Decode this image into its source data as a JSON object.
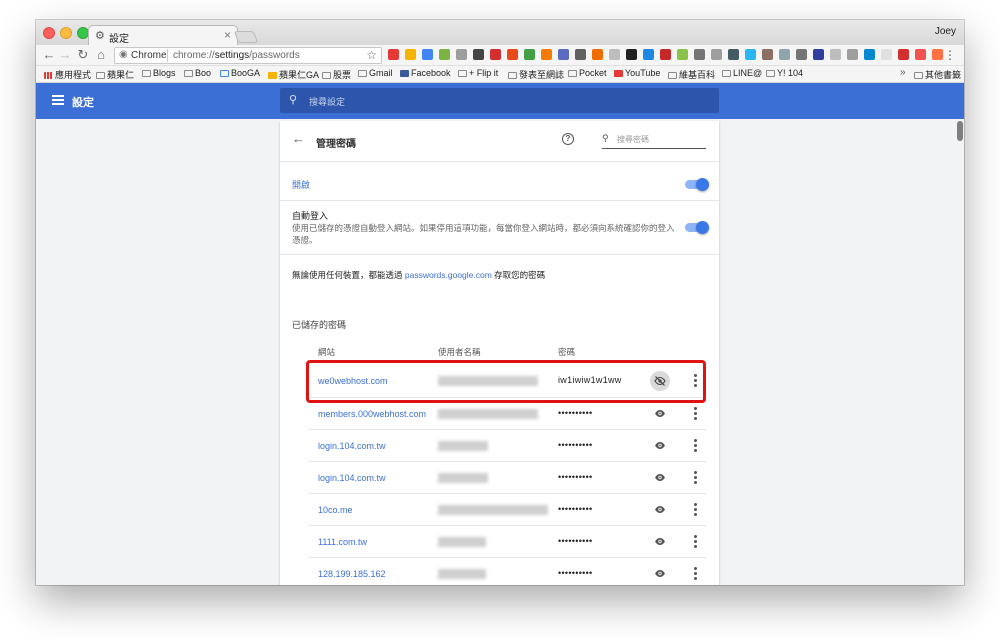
{
  "tab": {
    "title": "設定",
    "close": "×"
  },
  "profile": "Joey",
  "omnibox": {
    "scheme": "Chrome",
    "url_prefix": "chrome://",
    "url_host": "settings",
    "url_path": "/passwords"
  },
  "bookmarks": {
    "apps": "應用程式",
    "items": [
      "蘋果仁",
      "Blogs",
      "Boo",
      "BooGA",
      "蘋果仁GA",
      "股票",
      "Gmail",
      "Facebook",
      "+ Flip it",
      "發表至網誌",
      "Pocket",
      "YouTube",
      "維基百科",
      "LINE@",
      "Y! 104"
    ],
    "more": "»",
    "other": "其他書籤"
  },
  "settings_header": {
    "title": "設定",
    "search_placeholder": "搜尋設定"
  },
  "passwords": {
    "title": "管理密碼",
    "search_placeholder": "搜尋密碼",
    "enabled_label": "開啟",
    "autosignin_title": "自動登入",
    "autosignin_desc": "使用已儲存的憑證自動登入網站。如果停用這項功能，每當你登入網站時，都必須向系統確認你的登入憑證。",
    "info_before": "無論使用任何裝置，都能透過 ",
    "info_link": "passwords.google.com",
    "info_after": " 存取您的密碼",
    "saved_title": "已儲存的密碼",
    "col_site": "網站",
    "col_user": "使用者名稱",
    "col_password": "密碼",
    "rows": [
      {
        "site": "we0webhost.com",
        "password": "iw1iwiw1w1ww",
        "revealed": true
      },
      {
        "site": "members.000webhost.com",
        "password": "••••••••••",
        "revealed": false
      },
      {
        "site": "login.104.com.tw",
        "password": "••••••••••",
        "revealed": false
      },
      {
        "site": "login.104.com.tw",
        "password": "••••••••••",
        "revealed": false
      },
      {
        "site": "10co.me",
        "password": "••••••••••",
        "revealed": false
      },
      {
        "site": "1111.com.tw",
        "password": "••••••••••",
        "revealed": false
      },
      {
        "site": "128.199.185.162",
        "password": "••••••••••",
        "revealed": false
      }
    ]
  },
  "colors": {
    "accent": "#3b6fd6",
    "header": "#3b6fd6",
    "highlight": "#e01212"
  }
}
